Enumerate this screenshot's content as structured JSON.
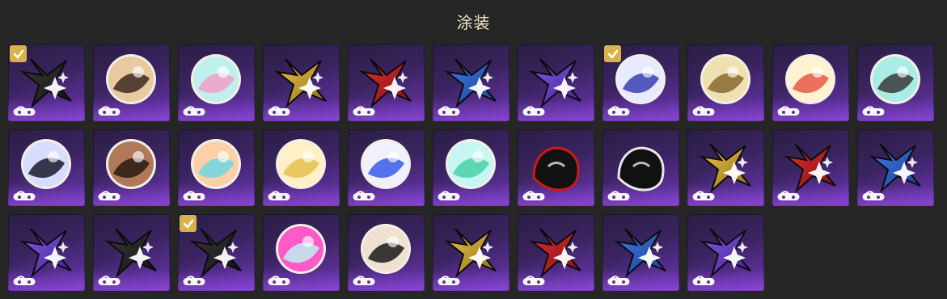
{
  "header": {
    "title": "涂装"
  },
  "colors": {
    "tile_gradient": [
      "#2b1d44",
      "#6d36b6"
    ],
    "check_gold": "#d9b24a"
  },
  "tiles": [
    {
      "icon": "black-star-icon",
      "selected": true,
      "colors": [
        "#3b3b3b",
        "#111111"
      ]
    },
    {
      "icon": "anime-girl-portrait-icon",
      "selected": false,
      "colors": [
        "#e8c9a0",
        "#3b2a20"
      ]
    },
    {
      "icon": "glass-orb-icon",
      "selected": false,
      "colors": [
        "#bff0ee",
        "#f0a0c8"
      ]
    },
    {
      "icon": "gold-star-icon",
      "selected": false,
      "colors": [
        "#f2c84b",
        "#8a6a18"
      ]
    },
    {
      "icon": "red-star-icon",
      "selected": false,
      "colors": [
        "#e63030",
        "#7a0f14"
      ]
    },
    {
      "icon": "blue-star-icon",
      "selected": false,
      "colors": [
        "#3d7df0",
        "#1b3e8a"
      ]
    },
    {
      "icon": "purple-star-icon",
      "selected": false,
      "colors": [
        "#8a5cf0",
        "#3b1f8a"
      ]
    },
    {
      "icon": "winged-crest-icon",
      "selected": true,
      "colors": [
        "#e8ebff",
        "#3a3fb0"
      ]
    },
    {
      "icon": "gold-emblem-icon",
      "selected": false,
      "colors": [
        "#efe0b0",
        "#8a6a30"
      ]
    },
    {
      "icon": "party-characters-icon",
      "selected": false,
      "colors": [
        "#fff2d0",
        "#e85a4a"
      ]
    },
    {
      "icon": "masked-figure-icon",
      "selected": false,
      "colors": [
        "#a8ece6",
        "#3a3a3a"
      ]
    },
    {
      "icon": "dark-hair-character-icon",
      "selected": false,
      "colors": [
        "#d8dcff",
        "#1a1a2a"
      ]
    },
    {
      "icon": "two-girls-portrait-icon",
      "selected": false,
      "colors": [
        "#b07a5a",
        "#2a1a14"
      ]
    },
    {
      "icon": "robot-head-icon",
      "selected": false,
      "colors": [
        "#ffd0a8",
        "#6fd6e0"
      ]
    },
    {
      "icon": "blonde-character-icon",
      "selected": false,
      "colors": [
        "#fff0c8",
        "#e8c050"
      ]
    },
    {
      "icon": "speed-wings-icon",
      "selected": false,
      "colors": [
        "#f0f0ff",
        "#3a5ae8"
      ]
    },
    {
      "icon": "cyan-planet-icon",
      "selected": false,
      "colors": [
        "#c8f6f2",
        "#4ad0a8"
      ]
    },
    {
      "icon": "shadow-hedgehog-icon",
      "selected": false,
      "colors": [
        "#111111",
        "#d01818"
      ]
    },
    {
      "icon": "joker-persona-icon",
      "selected": false,
      "colors": [
        "#111111",
        "#e8e8e8"
      ]
    },
    {
      "icon": "gold-star-icon",
      "selected": false,
      "colors": [
        "#f2c84b",
        "#8a6a18"
      ]
    },
    {
      "icon": "red-star-icon",
      "selected": false,
      "colors": [
        "#e63030",
        "#7a0f14"
      ]
    },
    {
      "icon": "blue-star-icon",
      "selected": false,
      "colors": [
        "#3d7df0",
        "#1b3e8a"
      ]
    },
    {
      "icon": "purple-star-icon",
      "selected": false,
      "colors": [
        "#8a5cf0",
        "#3b1f8a"
      ]
    },
    {
      "icon": "black-star-icon",
      "selected": false,
      "colors": [
        "#3b3b3b",
        "#111111"
      ]
    },
    {
      "icon": "black-star-icon",
      "selected": true,
      "colors": [
        "#3b3b3b",
        "#111111"
      ]
    },
    {
      "icon": "pink-cat-icon",
      "selected": false,
      "colors": [
        "#ff5ac8",
        "#bff0f2"
      ]
    },
    {
      "icon": "dark-hair-girl-portrait-icon",
      "selected": false,
      "colors": [
        "#f0e0d0",
        "#1a1a1a"
      ]
    },
    {
      "icon": "gold-star-icon",
      "selected": false,
      "colors": [
        "#f2c84b",
        "#8a6a18"
      ]
    },
    {
      "icon": "red-star-icon",
      "selected": false,
      "colors": [
        "#e63030",
        "#7a0f14"
      ]
    },
    {
      "icon": "blue-star-icon",
      "selected": false,
      "colors": [
        "#3d7df0",
        "#1b3e8a"
      ]
    },
    {
      "icon": "purple-star-icon",
      "selected": false,
      "colors": [
        "#8a5cf0",
        "#3b1f8a"
      ]
    }
  ]
}
